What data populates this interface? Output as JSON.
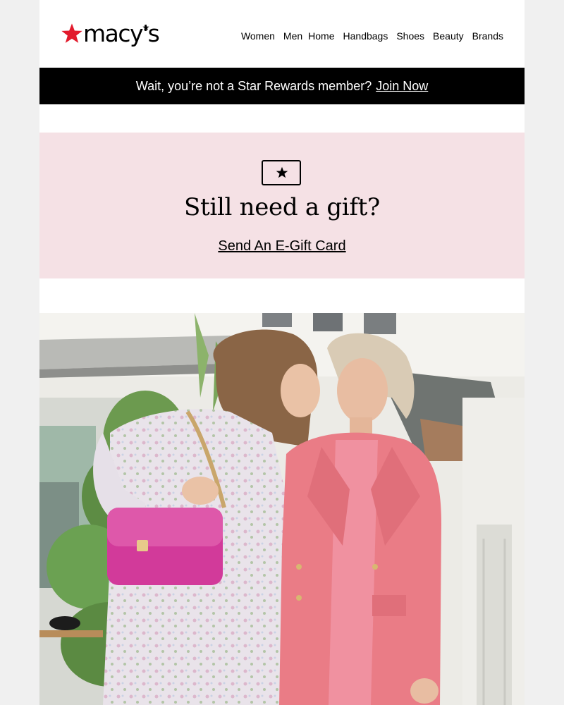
{
  "brand": {
    "logo_text": "macy's"
  },
  "nav": {
    "items": [
      "Women",
      "Men",
      "Home",
      "Handbags",
      "Shoes",
      "Beauty",
      "Brands"
    ]
  },
  "rewards_bar": {
    "message": "Wait, you’re not a Star Rewards member?",
    "link_label": "Join Now"
  },
  "gift_promo": {
    "icon": "star-card-icon",
    "title": "Still need a gift?",
    "link_label": "Send An E-Gift Card"
  },
  "hero": {
    "image": "two-women-pink-outfits-photo"
  },
  "colors": {
    "brand_red": "#e21a2c",
    "rewards_bg": "#000000",
    "gift_bg": "#f5e1e5",
    "blazer_pink": "#ea7c86",
    "bag_magenta": "#d23a9a"
  }
}
